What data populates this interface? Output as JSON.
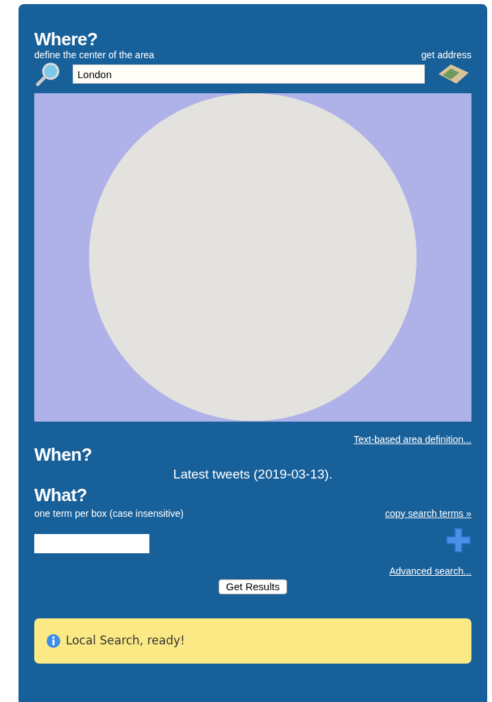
{
  "where": {
    "title": "Where?",
    "subtitle": "define the center of the area",
    "address_link": "get address",
    "location": "London"
  },
  "area_link": "Text-based area definition...",
  "when": {
    "title": "When?",
    "text": "Latest tweets (2019-03-13)."
  },
  "what": {
    "title": "What?",
    "subtitle": "one term per box (case insensitive)",
    "copy_link": "copy search terms »"
  },
  "advanced_link": "Advanced search...",
  "submit_button": "Get Results",
  "status": {
    "kind": "info",
    "text": "Local Search, ready!"
  }
}
